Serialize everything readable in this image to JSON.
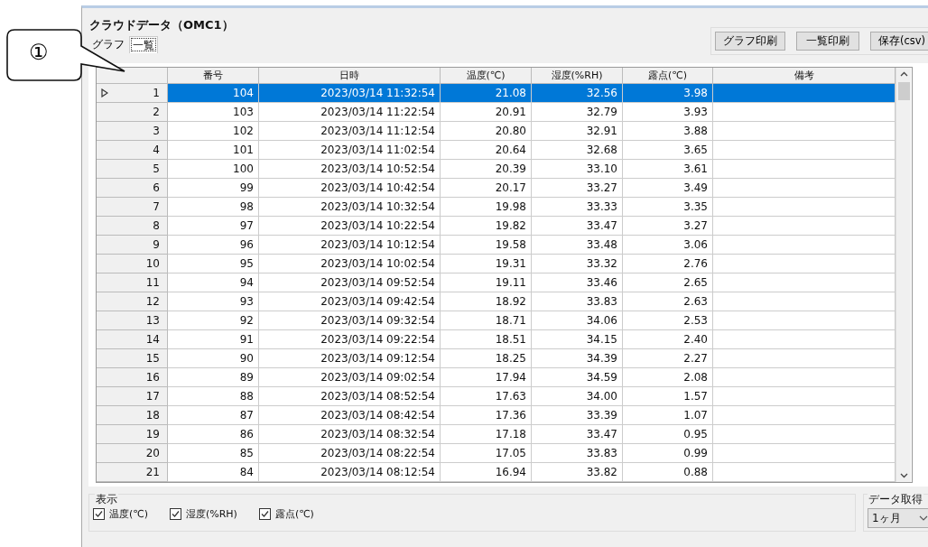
{
  "callout": {
    "text": "①"
  },
  "window": {
    "title": "クラウドデータ（OMC1）"
  },
  "tabs": [
    {
      "label": "グラフ",
      "selected": false
    },
    {
      "label": "一覧",
      "selected": true
    }
  ],
  "buttons": [
    "グラフ印刷",
    "一覧印刷",
    "保存(csv)"
  ],
  "table": {
    "columns": [
      "番号",
      "日時",
      "温度(℃)",
      "湿度(%RH)",
      "露点(℃)",
      "備考"
    ],
    "rows": [
      {
        "index": "1",
        "cells": [
          "104",
          "2023/03/14 11:32:54",
          "21.08",
          "32.56",
          "3.98"
        ],
        "selected": true
      },
      {
        "index": "2",
        "cells": [
          "103",
          "2023/03/14 11:22:54",
          "20.91",
          "32.79",
          "3.93"
        ],
        "selected": false
      },
      {
        "index": "3",
        "cells": [
          "102",
          "2023/03/14 11:12:54",
          "20.80",
          "32.91",
          "3.88"
        ],
        "selected": false
      },
      {
        "index": "4",
        "cells": [
          "101",
          "2023/03/14 11:02:54",
          "20.64",
          "32.68",
          "3.65"
        ],
        "selected": false
      },
      {
        "index": "5",
        "cells": [
          "100",
          "2023/03/14 10:52:54",
          "20.39",
          "33.10",
          "3.61"
        ],
        "selected": false
      },
      {
        "index": "6",
        "cells": [
          "99",
          "2023/03/14 10:42:54",
          "20.17",
          "33.27",
          "3.49"
        ],
        "selected": false
      },
      {
        "index": "7",
        "cells": [
          "98",
          "2023/03/14 10:32:54",
          "19.98",
          "33.33",
          "3.35"
        ],
        "selected": false
      },
      {
        "index": "8",
        "cells": [
          "97",
          "2023/03/14 10:22:54",
          "19.82",
          "33.47",
          "3.27"
        ],
        "selected": false
      },
      {
        "index": "9",
        "cells": [
          "96",
          "2023/03/14 10:12:54",
          "19.58",
          "33.48",
          "3.06"
        ],
        "selected": false
      },
      {
        "index": "10",
        "cells": [
          "95",
          "2023/03/14 10:02:54",
          "19.31",
          "33.32",
          "2.76"
        ],
        "selected": false
      },
      {
        "index": "11",
        "cells": [
          "94",
          "2023/03/14 09:52:54",
          "19.11",
          "33.46",
          "2.65"
        ],
        "selected": false
      },
      {
        "index": "12",
        "cells": [
          "93",
          "2023/03/14 09:42:54",
          "18.92",
          "33.83",
          "2.63"
        ],
        "selected": false
      },
      {
        "index": "13",
        "cells": [
          "92",
          "2023/03/14 09:32:54",
          "18.71",
          "34.06",
          "2.53"
        ],
        "selected": false
      },
      {
        "index": "14",
        "cells": [
          "91",
          "2023/03/14 09:22:54",
          "18.51",
          "34.15",
          "2.40"
        ],
        "selected": false
      },
      {
        "index": "15",
        "cells": [
          "90",
          "2023/03/14 09:12:54",
          "18.25",
          "34.39",
          "2.27"
        ],
        "selected": false
      },
      {
        "index": "16",
        "cells": [
          "89",
          "2023/03/14 09:02:54",
          "17.94",
          "34.59",
          "2.08"
        ],
        "selected": false
      },
      {
        "index": "17",
        "cells": [
          "88",
          "2023/03/14 08:52:54",
          "17.63",
          "34.00",
          "1.57"
        ],
        "selected": false
      },
      {
        "index": "18",
        "cells": [
          "87",
          "2023/03/14 08:42:54",
          "17.36",
          "33.39",
          "1.07"
        ],
        "selected": false
      },
      {
        "index": "19",
        "cells": [
          "86",
          "2023/03/14 08:32:54",
          "17.18",
          "33.47",
          "0.95"
        ],
        "selected": false
      },
      {
        "index": "20",
        "cells": [
          "85",
          "2023/03/14 08:22:54",
          "17.05",
          "33.83",
          "0.99"
        ],
        "selected": false
      },
      {
        "index": "21",
        "cells": [
          "84",
          "2023/03/14 08:12:54",
          "16.94",
          "33.82",
          "0.88"
        ],
        "selected": false
      }
    ]
  },
  "display_group": {
    "label": "表示",
    "checkboxes": [
      {
        "label": "温度(℃)",
        "checked": true
      },
      {
        "label": "湿度(%RH)",
        "checked": true
      },
      {
        "label": "露点(℃)",
        "checked": true
      }
    ]
  },
  "fetch_group": {
    "label": "データ取得",
    "value": "1ヶ月"
  }
}
